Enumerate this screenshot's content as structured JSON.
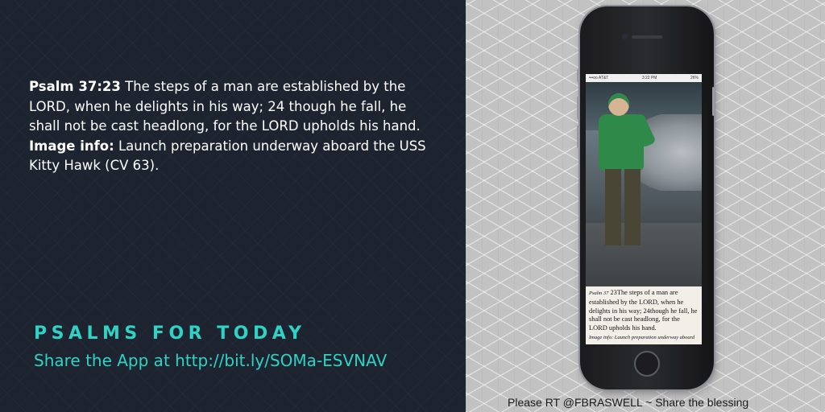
{
  "left": {
    "verse_ref": "Psalm 37:23",
    "verse_text": " The steps of a man are established by the LORD, when he delights in his way; 24 though he fall, he shall not be cast headlong, for the LORD upholds his hand.",
    "image_info_label": "Image info:",
    "image_info_text": " Launch preparation underway aboard the USS Kitty Hawk (CV 63).",
    "brand_title": "PSALMS FOR TODAY",
    "share_line": "Share the App at  http://bit.ly/SOMa-ESVNAV"
  },
  "right": {
    "caption": "Please RT @FBRASWELL ~ Share the blessing"
  },
  "phone": {
    "status_left": "•••oo AT&T",
    "status_time": "3:22 PM",
    "status_right": "26%",
    "screen_ref": "Psalm 37",
    "screen_verse": " 23The steps of a man are established by the LORD, when he delights in his way; 24though he fall, he shall not be cast headlong, for the LORD upholds his hand.",
    "screen_info": "Image info: Launch preparation underway aboard the USS Kitty Hawk (CV 63)."
  },
  "colors": {
    "accent": "#2fd3c6",
    "left_bg": "#1d2430",
    "right_bg": "#c2c2c2"
  }
}
